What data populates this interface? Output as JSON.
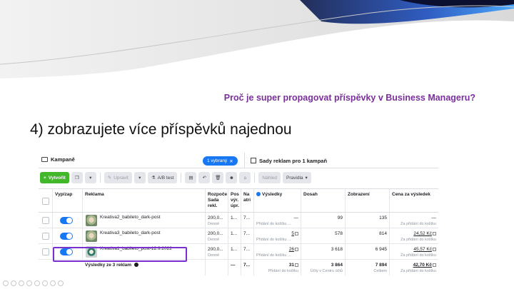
{
  "slide": {
    "subtitle": "Proč je super propagovat příspěvky v Business Manageru?",
    "heading": "4) zobrazujete více příspěvků najednou"
  },
  "tabs": {
    "campaigns": "Kampaně",
    "selected_pill": "1 vybraný",
    "adsets": "Sady reklam pro 1 kampaň"
  },
  "toolbar": {
    "create": "Vytvořit",
    "edit": "Upravit",
    "ab_test": "A/B test",
    "preview": "Náhled",
    "rules": "Pravidla"
  },
  "table": {
    "headers": {
      "onoff": "Vyp/zap",
      "ad": "Reklama",
      "budget": "Rozpoče Sada rekl.",
      "pos": "Pos výr. úpr.",
      "na": "Na atri",
      "results": "Výsledky",
      "reach": "Dosah",
      "impressions": "Zobrazení",
      "cpr": "Cena za výsledek"
    },
    "budget_sub": "Sada rekl",
    "rows": [
      {
        "name": "Kreativa2_babileto_dark-post",
        "budget": "200,0...",
        "budget_sub": "Denně",
        "pos": "1...",
        "na": "7...",
        "results": "—",
        "results_sub": "Přidání do košíku ...",
        "reach": "99",
        "impressions": "135",
        "cpr": "—",
        "cpr_sub": "Za přidání do košíku"
      },
      {
        "name": "Kreativa3_babileto_dark-post",
        "budget": "200,0...",
        "budget_sub": "Denně",
        "pos": "1...",
        "na": "7...",
        "results": "5",
        "results_sub": "Přidání do košíku ...",
        "reach": "578",
        "impressions": "814",
        "cpr": "24,52 Kč",
        "cpr_sub": "Za přidání do košíku"
      },
      {
        "name": "Kreativa1_babileto_post-12.9.2022",
        "budget": "200,0...",
        "budget_sub": "Denně",
        "pos": "1...",
        "na": "7...",
        "results": "26",
        "results_sub": "Přidání do košíku ...",
        "reach": "3 618",
        "impressions": "6 945",
        "cpr": "45,57 Kč",
        "cpr_sub": "Za přidání do košíku"
      }
    ],
    "summary": {
      "label": "Výsledky ze 3 reklam",
      "pos": "—",
      "na": "7...",
      "results": "31",
      "results_sub": "Přidání do košíku",
      "reach": "3 864",
      "reach_sub": "Účty v Centru účtů",
      "impressions": "7 894",
      "impressions_sub": "Celkem",
      "cpr": "42,70 Kč",
      "cpr_sub": "Za přidání do košíku"
    }
  },
  "colors": {
    "accent": "#1877f2",
    "create_button": "#42b72a",
    "title_purple": "#7a2f9a",
    "highlight_box": "#7a2fd0"
  }
}
